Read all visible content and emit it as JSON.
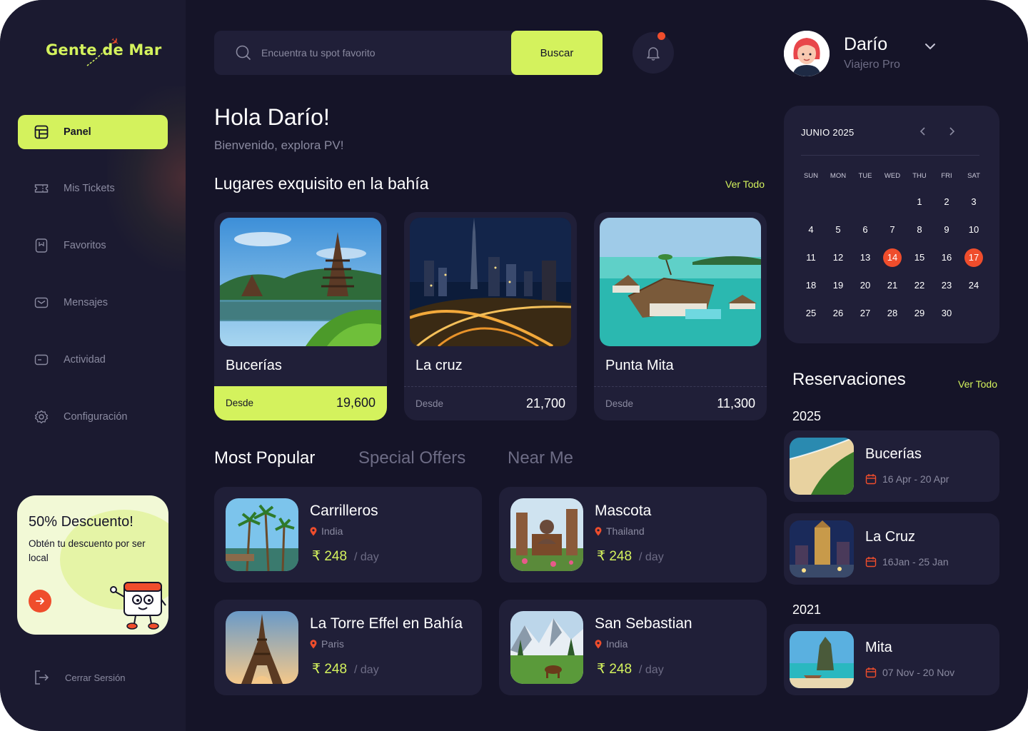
{
  "brand": {
    "name": "Gente de Mar"
  },
  "sidebar": {
    "items": [
      {
        "label": "Panel",
        "icon": "dashboard-icon",
        "active": true
      },
      {
        "label": "Mis Tickets",
        "icon": "ticket-icon"
      },
      {
        "label": "Favoritos",
        "icon": "bookmark-icon"
      },
      {
        "label": "Mensajes",
        "icon": "mail-icon"
      },
      {
        "label": "Actividad",
        "icon": "activity-icon"
      },
      {
        "label": "Configuración",
        "icon": "gear-icon"
      }
    ],
    "promo": {
      "title": "50% Descuento!",
      "text": "Obtén tu descuento por ser local",
      "button_icon": "arrow-right-icon"
    },
    "logout": "Cerrar Sersión"
  },
  "search": {
    "placeholder": "Encuentra tu spot favorito",
    "button": "Buscar"
  },
  "greeting": {
    "title": "Hola Darío!",
    "subtitle": "Bienvenido, explora PV!"
  },
  "places": {
    "title": "Lugares exquisito en la bahía",
    "see_all": "Ver Todo",
    "from_label": "Desde",
    "items": [
      {
        "name": "Bucerías",
        "price": "19,600",
        "highlight": true
      },
      {
        "name": "La cruz",
        "price": "21,700"
      },
      {
        "name": "Punta Mita",
        "price": "11,300"
      }
    ]
  },
  "tabs": [
    "Most Popular",
    "Special Offers",
    "Near Me"
  ],
  "popular": [
    {
      "name": "Carrilleros",
      "location": "India",
      "price": "₹ 248",
      "unit": "/ day"
    },
    {
      "name": "Mascota",
      "location": "Thailand",
      "price": "₹ 248",
      "unit": "/ day"
    },
    {
      "name": "La Torre Effel en Bahía",
      "location": "Paris",
      "price": "₹ 248",
      "unit": "/ day"
    },
    {
      "name": "San Sebastian",
      "location": "India",
      "price": "₹ 248",
      "unit": "/ day"
    }
  ],
  "profile": {
    "name": "Darío",
    "role": "Viajero Pro"
  },
  "calendar": {
    "title": "JUNIO 2025",
    "weekdays": [
      "SUN",
      "MON",
      "TUE",
      "WED",
      "THU",
      "FRI",
      "SAT"
    ],
    "days": [
      "1",
      "2",
      "3",
      "4",
      "5",
      "6",
      "7",
      "8",
      "9",
      "10",
      "11",
      "12",
      "13",
      "14",
      "15",
      "16",
      "17",
      "18",
      "19",
      "20",
      "21",
      "22",
      "23",
      "24",
      "25",
      "26",
      "27",
      "28",
      "29",
      "30"
    ],
    "selected": [
      "14",
      "17"
    ]
  },
  "reservations": {
    "title": "Reservaciones",
    "see_all": "Ver Todo",
    "years": [
      "2025",
      "2021"
    ],
    "items": [
      {
        "name": "Bucerías",
        "dates": "16 Apr - 20 Apr"
      },
      {
        "name": "La Cruz",
        "dates": "16Jan - 25 Jan"
      },
      {
        "name": "Mita",
        "dates": "07 Nov - 20 Nov"
      }
    ]
  },
  "colors": {
    "accent": "#d4f25d",
    "alert": "#ef4d2c",
    "background": "#151428",
    "card": "#201f38"
  }
}
